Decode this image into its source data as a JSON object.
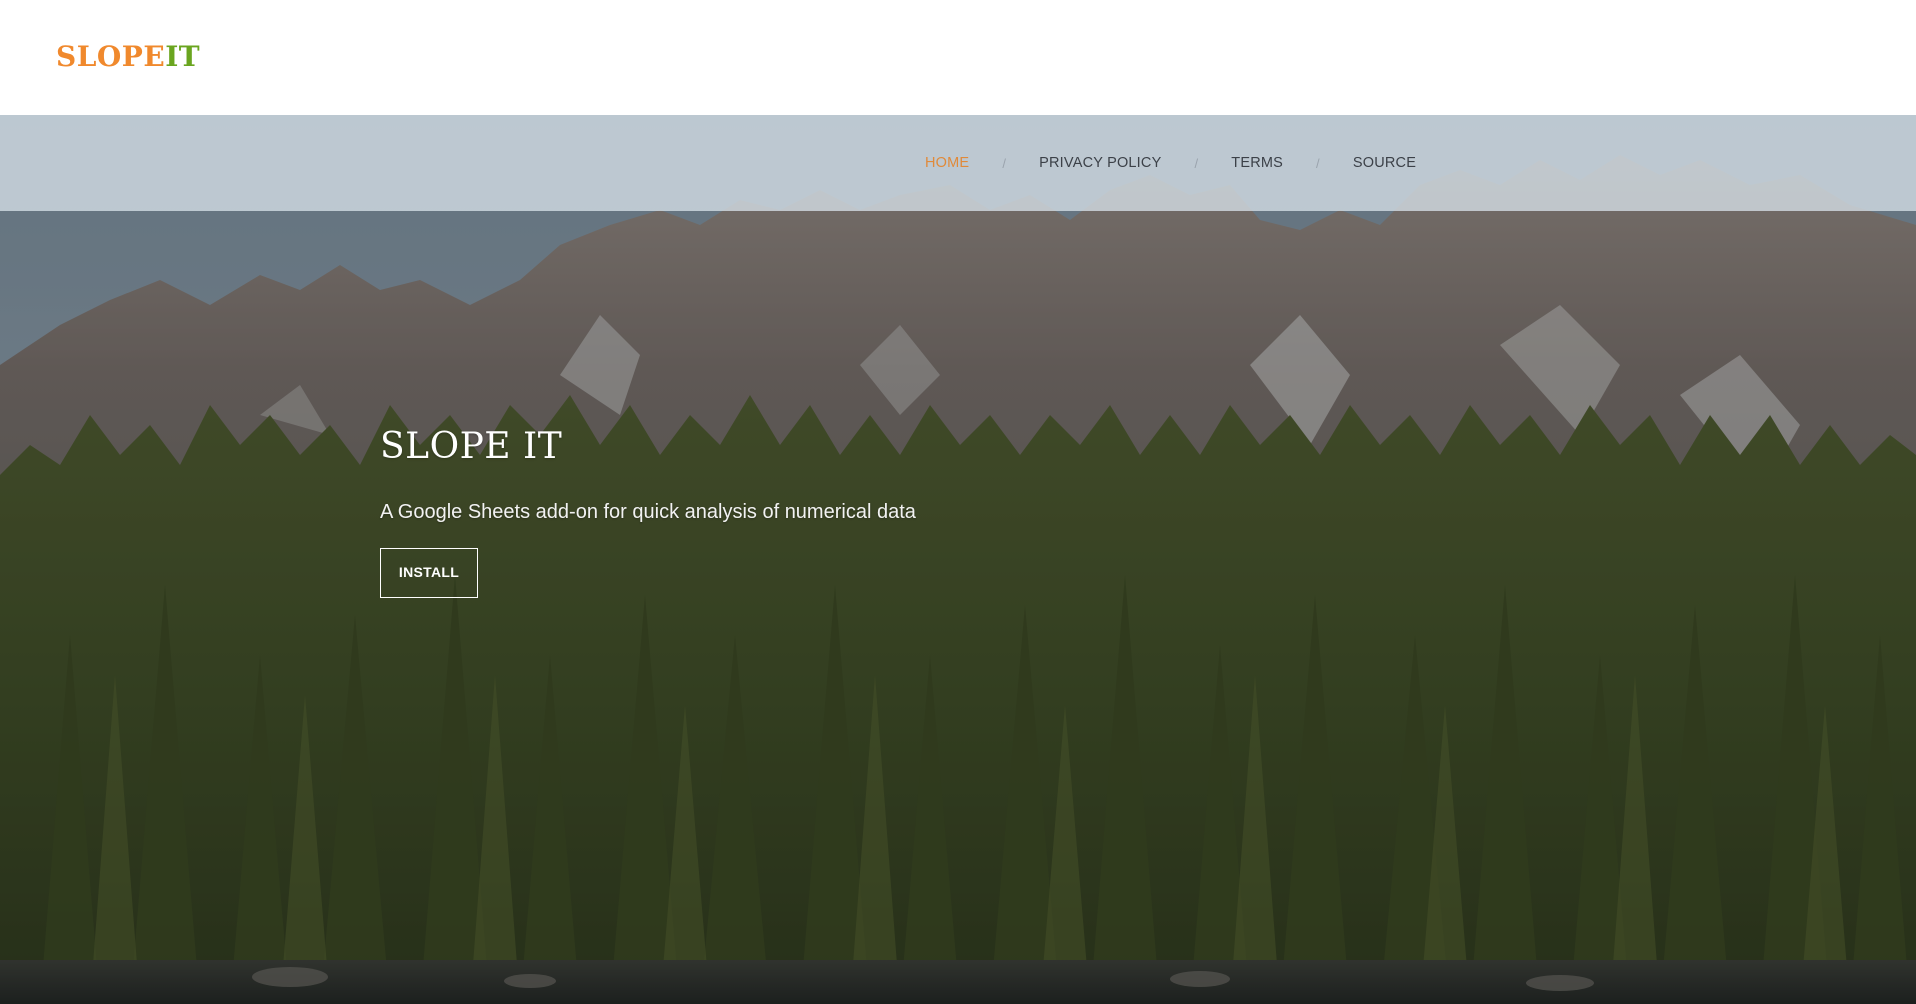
{
  "brand": {
    "logo_part1": "SLOPE",
    "logo_part2": "IT",
    "color_part1": "#f0892d",
    "color_part2": "#6aa51f"
  },
  "nav": {
    "items": [
      {
        "label": "HOME",
        "active": true
      },
      {
        "label": "PRIVACY POLICY",
        "active": false
      },
      {
        "label": "TERMS",
        "active": false
      },
      {
        "label": "SOURCE",
        "active": false
      }
    ],
    "separator": "/",
    "active_color": "#e08a3a"
  },
  "hero": {
    "title": "SLOPE IT",
    "subtitle": "A Google Sheets add-on for quick analysis of numerical data",
    "button_label": "INSTALL"
  }
}
